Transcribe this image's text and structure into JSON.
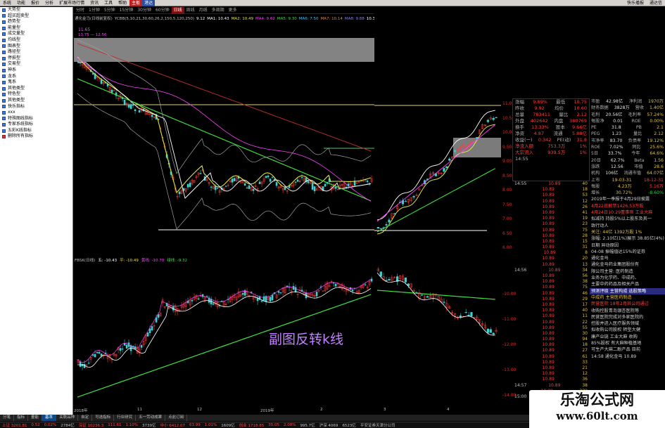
{
  "menubar": {
    "left": [
      "系统",
      "功能",
      "报价",
      "分析",
      "扩展市场行情",
      "资讯",
      "工具",
      "帮助"
    ],
    "right_red": "主板",
    "right_blue": "港达",
    "right_text": [
      "快乐播报",
      "通达信"
    ]
  },
  "sidebar": {
    "items": [
      {
        "label": "大势型",
        "hl": false
      },
      {
        "label": "超买超卖型",
        "hl": false
      },
      {
        "label": "趋势型",
        "hl": false
      },
      {
        "label": "能量型",
        "hl": false
      },
      {
        "label": "成交量型",
        "hl": false
      },
      {
        "label": "均线型",
        "hl": false
      },
      {
        "label": "图表型",
        "hl": false
      },
      {
        "label": "路径型",
        "hl": false
      },
      {
        "label": "停损型",
        "hl": false
      },
      {
        "label": "交易型",
        "hl": false
      },
      {
        "label": "神系",
        "hl": false
      },
      {
        "label": "龙系",
        "hl": false
      },
      {
        "label": "鬼系",
        "hl": false
      },
      {
        "label": "其他类型",
        "hl": false
      },
      {
        "label": "特色型",
        "hl": false
      },
      {
        "label": "其他类型",
        "hl": false
      },
      {
        "label": "快乐指标",
        "hl": false
      },
      {
        "label": "xxx",
        "hl": false
      },
      {
        "label": "特殊图线指标",
        "hl": false
      },
      {
        "label": "专家系统指标",
        "hl": false
      },
      {
        "label": "五彩K线指标",
        "hl": false
      },
      {
        "label": "删除所有指标",
        "hl": true
      }
    ]
  },
  "period_bar": {
    "items": [
      "分时",
      "1分钟",
      "5分钟",
      "15分钟",
      "30分钟",
      "60分钟",
      "日线",
      "周线",
      "月线",
      "多周期",
      "更多"
    ],
    "active_index": 6
  },
  "main_legend": [
    {
      "text": "通化金马(日线前复权)",
      "color": "#c0c0c0"
    },
    {
      "text": "YCBB(5,10,21,30,60,26,2,150,5,120,250)",
      "color": "#c0c0c0"
    },
    {
      "text": "9.12",
      "color": "#ffffff"
    },
    {
      "text": "MA1: 10.43",
      "color": "#ffffff"
    },
    {
      "text": "MA2: 10.49",
      "color": "#e0e040"
    },
    {
      "text": "MA4: 9.62",
      "color": "#ff40ff"
    },
    {
      "text": "MA5: 9.30",
      "color": "#40e040"
    },
    {
      "text": "MA6: 7.50",
      "color": "#40c0ff"
    },
    {
      "text": "MA7: 10.14",
      "color": "#e08040"
    },
    {
      "text": "MA8: 9.88",
      "color": "#8080ff"
    },
    {
      "text": "10.30",
      "color": "#ffffff"
    }
  ],
  "main_chart": {
    "price_box_label": "11.65",
    "price_box_sub": "13.75 — 12.56"
  },
  "sub_legend": [
    {
      "text": "FBSK(日线)",
      "color": "#c0c0c0"
    },
    {
      "text": "五: -10.43",
      "color": "#ffffff"
    },
    {
      "text": "平: -10.49",
      "color": "#e0e040"
    },
    {
      "text": "黄线: -10.70",
      "color": "#ff40ff"
    },
    {
      "text": "绿线: -9.32",
      "color": "#40e040"
    }
  ],
  "y_axis_main": [
    "11.00",
    "10.50",
    "10.00",
    "9.50",
    "9.00",
    "8.50",
    "8.00",
    "7.50",
    "7.00",
    "6.50",
    "6.00"
  ],
  "y_axis_sub": [
    "-10.00",
    "-11.00",
    "-12.00",
    "-13.00",
    "-14.00"
  ],
  "quote": {
    "rows": [
      {
        "lb": "涨幅",
        "v1": "9.89%",
        "lb2": "最低",
        "v2": "10.75"
      },
      {
        "lb": "昨收",
        "v1": "9.92",
        "lb2": "均价",
        "v2": "10.60"
      },
      {
        "lb": "总量",
        "v1": "783411",
        "lb2": "量比",
        "v2": "2.12"
      },
      {
        "lb": "外盘",
        "v1": "402642",
        "lb2": "内盘",
        "v2": "380769"
      },
      {
        "lb": "换手",
        "v1": "13.33%",
        "lb2": "股本",
        "v2": "9.66亿"
      },
      {
        "lb": "净资",
        "v1": "4.87",
        "lb2": "流通",
        "v2": "5.88亿"
      },
      {
        "lb": "收益(一)",
        "v1": "0.342",
        "lb2": "PE(动)",
        "v2": "31.8"
      }
    ],
    "flows": [
      {
        "lb": "净流入额",
        "v": "753.3万",
        "p": "1%"
      },
      {
        "lb": "大宗流入",
        "v": "939.5万",
        "p": "1%"
      }
    ],
    "time": "14:55"
  },
  "ticks": [
    {
      "tm": "14:55",
      "pr": "10.89",
      "vol": "40"
    },
    {
      "tm": "",
      "pr": "10.89",
      "vol": "18"
    },
    {
      "tm": "",
      "pr": "10.89",
      "vol": "53"
    },
    {
      "tm": "",
      "pr": "10.89",
      "vol": "12"
    },
    {
      "tm": "",
      "pr": "10.89",
      "vol": "26"
    },
    {
      "tm": "",
      "pr": "10.89",
      "vol": "41"
    },
    {
      "tm": "",
      "pr": "10.89",
      "vol": "19"
    },
    {
      "tm": "",
      "pr": "10.89",
      "vol": "23"
    },
    {
      "tm": "",
      "pr": "10.89",
      "vol": "75"
    },
    {
      "tm": "",
      "pr": "10.89",
      "vol": "28"
    },
    {
      "tm": "",
      "pr": "10.89",
      "vol": "15"
    },
    {
      "tm": "",
      "pr": "10.89",
      "vol": "31"
    },
    {
      "tm": "",
      "pr": "10.89",
      "vol": "8"
    },
    {
      "tm": "",
      "pr": "10.89",
      "vol": "20"
    },
    {
      "tm": "",
      "pr": "10.89",
      "vol": "13"
    },
    {
      "tm": "14:56",
      "pr": "10.89",
      "vol": "34"
    },
    {
      "tm": "",
      "pr": "10.89",
      "vol": "56"
    },
    {
      "tm": "",
      "pr": "10.89",
      "vol": "38"
    },
    {
      "tm": "",
      "pr": "10.89",
      "vol": "75"
    },
    {
      "tm": "",
      "pr": "10.89",
      "vol": "46"
    },
    {
      "tm": "",
      "pr": "10.89",
      "vol": "29"
    },
    {
      "tm": "",
      "pr": "10.89",
      "vol": "17"
    },
    {
      "tm": "",
      "pr": "10.89",
      "vol": "40"
    },
    {
      "tm": "",
      "pr": "10.89",
      "vol": "11"
    },
    {
      "tm": "",
      "pr": "10.89",
      "vol": "22"
    },
    {
      "tm": "",
      "pr": "10.89",
      "vol": "55"
    },
    {
      "tm": "",
      "pr": "10.89",
      "vol": "30"
    },
    {
      "tm": "",
      "pr": "10.89",
      "vol": "94"
    },
    {
      "tm": "",
      "pr": "10.89",
      "vol": "18"
    },
    {
      "tm": "",
      "pr": "10.89",
      "vol": "27"
    },
    {
      "tm": "",
      "pr": "10.89",
      "vol": "61"
    },
    {
      "tm": "",
      "pr": "10.89",
      "vol": "33"
    },
    {
      "tm": "",
      "pr": "10.89",
      "vol": "21"
    },
    {
      "tm": "",
      "pr": "10.89",
      "vol": "12"
    },
    {
      "tm": "",
      "pr": "10.89",
      "vol": "36"
    },
    {
      "tm": "14:57",
      "pr": "10.89",
      "vol": "38"
    },
    {
      "tm": "",
      "pr": "10.89",
      "vol": "332"
    },
    {
      "tm": "15:00",
      "pr": "10.89",
      "vol": "29"
    }
  ],
  "f10": {
    "rows": [
      {
        "lb": "市盈",
        "v": "42.98亿",
        "lb2": "净利润",
        "v2": "1970万"
      },
      {
        "lb": "财务数据",
        "v": "3828万",
        "lb2": "营收",
        "v2": "1.40亿"
      },
      {
        "lb": "毛利",
        "v": "20.56亿",
        "lb2": "毛利率",
        "v2": "57.24%"
      },
      {
        "lb": "每股净",
        "v": "0.01",
        "lb2": "ROE",
        "v2": "0.00%"
      },
      {
        "lb": "PE",
        "v": "31.8",
        "lb2": "PB",
        "v2": "2.1"
      },
      {
        "lb": "PEG",
        "v": "1.23",
        "lb2": "量比",
        "v2": "2.12"
      },
      {
        "lb": "市净率",
        "v": "83.70",
        "lb2": "负债率",
        "v2": "19.12%"
      },
      {
        "lb": "ROE",
        "v": "7.02%",
        "lb2": "同比",
        "v2": "25.6%"
      },
      {
        "lb": "5日",
        "v": "33.7%",
        "lb2": "今年",
        "v2": "64.6%"
      },
      {
        "lb": "20日",
        "v": "62.7%",
        "lb2": "Beta",
        "v2": "1.56"
      },
      {
        "lb": "涨跌",
        "v": "12.56",
        "lb2": "市值",
        "v2": "28.6"
      },
      {
        "lb": "机构",
        "v": "106亿",
        "lb2": "流通市值",
        "v2": "64.07亿"
      }
    ],
    "dates": [
      {
        "lb": "上市",
        "v": "19-03-31",
        "v2": "18-12-31"
      },
      {
        "lb": "每股",
        "v": "4.23万",
        "v2": "5.16万"
      },
      {
        "lb": "增长",
        "v": "30.72%",
        "v2": "-8.60%"
      }
    ],
    "notes": [
      {
        "t": "2019年一季报于4月29日披露",
        "c": "w"
      },
      {
        "t": "4月22日解禁1426.53万股",
        "c": "red"
      },
      {
        "t": "4月24日10:29董事席 工业大麻",
        "c": "red"
      },
      {
        "t": "拟减持 持股5%以上股东及其一",
        "c": "w"
      },
      {
        "t": "致行动人",
        "c": "w"
      },
      {
        "t": "关注: 44亿 1392万股 1%",
        "c": "yellow"
      },
      {
        "t": "涨幅: 2.10亿(1%)展示 38.85亿(4%)",
        "c": "w"
      },
      {
        "t": "日期   异动原因",
        "c": "w"
      },
      {
        "t": "04-08  振幅值达15%的证券",
        "c": "w"
      },
      {
        "t": "通化金马",
        "c": "w"
      },
      {
        "t": "通化金马药业集团股份有",
        "c": "w"
      },
      {
        "t": "限公司主营: 医药制造",
        "c": "w"
      },
      {
        "t": "业务为化学药、中成药、",
        "c": "w"
      },
      {
        "t": "主要中药药品及相关产品",
        "c": "w"
      },
      {
        "t": "预测评级  主营构成  选股策略",
        "c": "hl"
      },
      {
        "t": "中成药  主营医药制造",
        "c": "yellow"
      },
      {
        "t": "民营医院  18年2月其公司通过",
        "c": "red"
      },
      {
        "t": "收购控股青岛银杏医院等",
        "c": "w"
      },
      {
        "t": "民营医院完成对多家医院的",
        "c": "w"
      },
      {
        "t": "控股并进入医疗服务领域",
        "c": "w"
      },
      {
        "t": "拟收购公司股权 转型大健",
        "c": "w"
      },
      {
        "t": "康产业链 工业大麻 收购",
        "c": "w"
      },
      {
        "t": "85%股权 有大麻种植基地",
        "c": "w"
      },
      {
        "t": "可生产大麻二酚产品 目前",
        "c": "w"
      },
      {
        "t": "14:58  通化金马 10.89",
        "c": "w"
      }
    ]
  },
  "overlay_text": "副图反转k线",
  "watermark": {
    "line1": "乐淘公式网",
    "line2": "www.60lt.com"
  },
  "bottom_tabs": {
    "items": [
      "分笔",
      "指标",
      "量能",
      "基本",
      "关联品种",
      "自定",
      "可选指标",
      "行业研究",
      "五一劳动成果",
      "点此订阅"
    ],
    "active_index": 3
  },
  "statusbar": [
    {
      "t": "上证 3201.81",
      "c": "r"
    },
    {
      "t": "0.52",
      "c": "r"
    },
    {
      "t": "0.02%",
      "c": "r"
    },
    {
      "t": "2784亿",
      "c": "w"
    },
    {
      "t": "深证 10236.3",
      "c": "r"
    },
    {
      "t": "111.61",
      "c": "r"
    },
    {
      "t": "1.10%",
      "c": "r"
    },
    {
      "t": "3739亿",
      "c": "w"
    },
    {
      "t": "中小 6412.07",
      "c": "r"
    },
    {
      "t": "63.99",
      "c": "r"
    },
    {
      "t": "1.01%",
      "c": "r"
    },
    {
      "t": "1609亿",
      "c": "w"
    },
    {
      "t": "创业 1718.85",
      "c": "r"
    },
    {
      "t": "35.05",
      "c": "r"
    },
    {
      "t": "2.08%",
      "c": "r"
    },
    {
      "t": "995.7亿",
      "c": "w"
    },
    {
      "t": "沪深 4069",
      "c": "w"
    },
    {
      "t": "6523亿",
      "c": "w"
    },
    {
      "t": "平安证券天津分公司",
      "c": "w"
    }
  ],
  "time_axis": [
    "2018年",
    "11",
    "12",
    "2019年",
    "2",
    "3",
    "4"
  ],
  "colors": {
    "up": "#ff3c3c",
    "down": "#40d0d0",
    "ma_white": "#ffffff",
    "ma_yellow": "#e0e040",
    "ma_magenta": "#ff40ff",
    "ma_green": "#40e040",
    "ma_red": "#c03030",
    "band": "#a0a0a0"
  }
}
